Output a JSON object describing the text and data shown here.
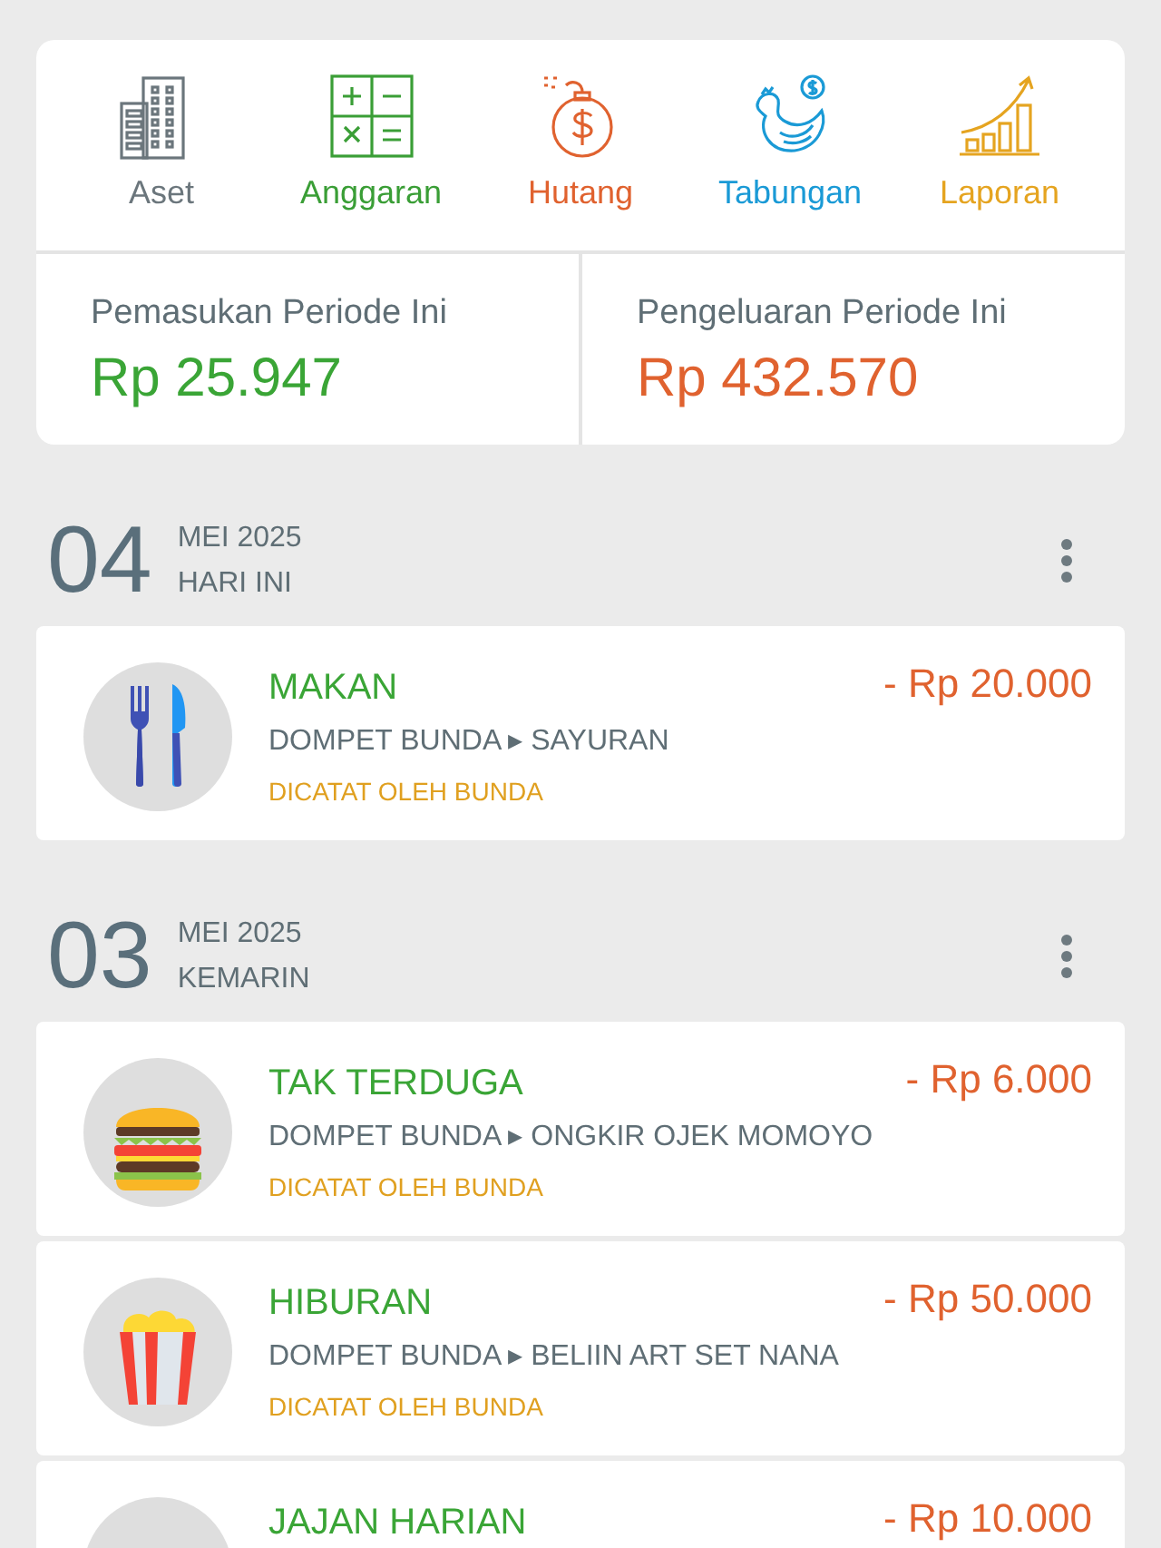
{
  "shortcuts": [
    {
      "label": "Aset",
      "kind": "building",
      "color": "#6b767c"
    },
    {
      "label": "Anggaran",
      "kind": "calculator",
      "color": "#3a9e36"
    },
    {
      "label": "Hutang",
      "kind": "bomb",
      "color": "#e0622f"
    },
    {
      "label": "Tabungan",
      "kind": "hen",
      "color": "#1a9ad6"
    },
    {
      "label": "Laporan",
      "kind": "chart",
      "color": "#e5a420"
    }
  ],
  "summary": [
    {
      "label": "Pemasukan Periode Ini",
      "amount": "Rp 25.947",
      "kind": "income"
    },
    {
      "label": "Pengeluaran Periode Ini",
      "amount": "Rp 432.570",
      "kind": "expense"
    }
  ],
  "days": [
    {
      "day": "04",
      "month": "MEI 2025",
      "relative": "HARI INI",
      "transactions": [
        {
          "category": "MAKAN",
          "account": "DOMPET BUNDA ▸ SAYURAN",
          "recorded_by": "DICATAT OLEH BUNDA",
          "amount": "- Rp 20.000",
          "kind": "cutlery"
        }
      ]
    },
    {
      "day": "03",
      "month": "MEI 2025",
      "relative": "KEMARIN",
      "transactions": [
        {
          "category": "TAK TERDUGA",
          "account": "DOMPET BUNDA ▸ ONGKIR OJEK MOMOYO",
          "recorded_by": "DICATAT OLEH BUNDA",
          "amount": "- Rp 6.000",
          "kind": "burger"
        },
        {
          "category": "HIBURAN",
          "account": "DOMPET BUNDA ▸ BELIIN ART SET NANA",
          "recorded_by": "DICATAT OLEH BUNDA",
          "amount": "- Rp 50.000",
          "kind": "popcorn"
        },
        {
          "category": "JAJAN HARIAN",
          "amount": "- Rp 10.000",
          "kind": "unknown"
        }
      ]
    }
  ]
}
